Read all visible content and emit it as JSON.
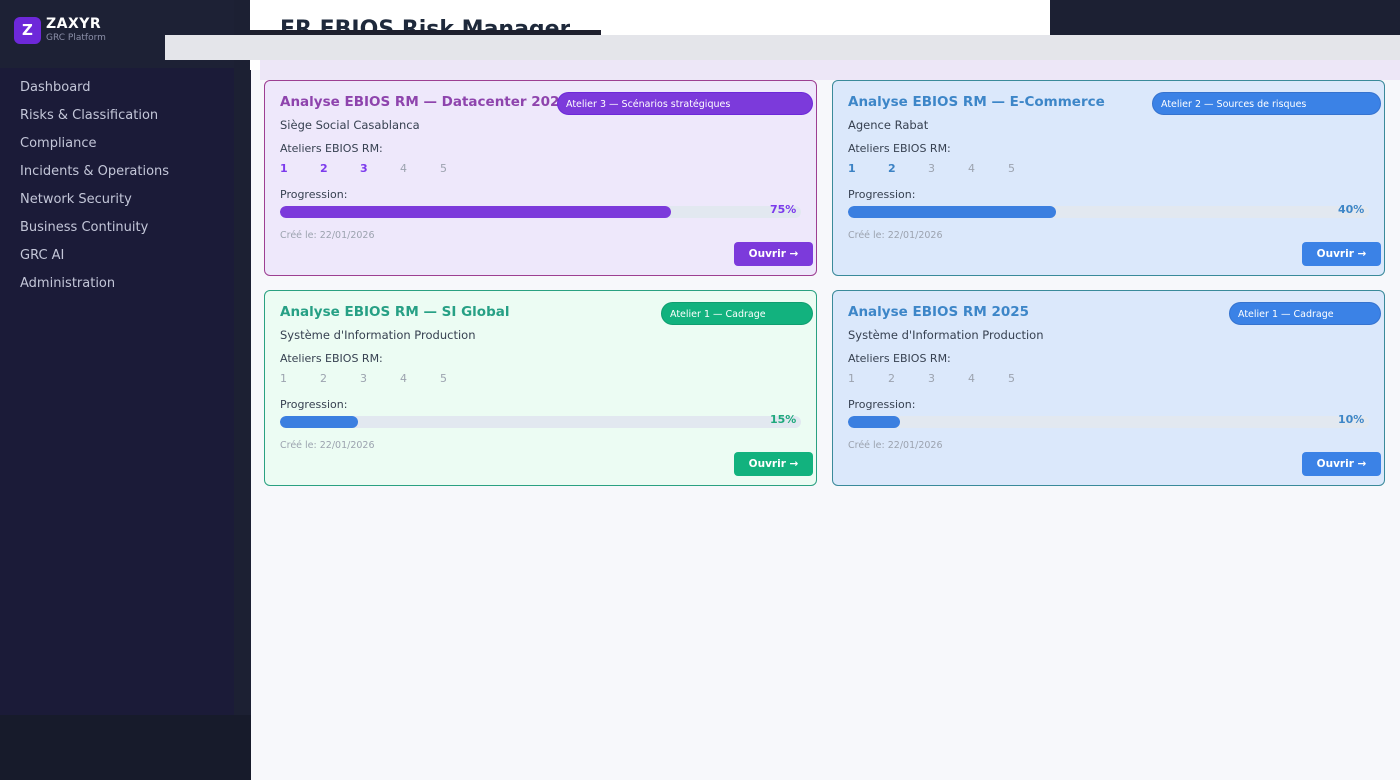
{
  "brand": {
    "logo_letter": "Z",
    "name": "ZAXYR",
    "subtitle": "GRC Platform"
  },
  "sidebar": {
    "items": [
      {
        "label": "Dashboard"
      },
      {
        "label": "Risks & Classification"
      },
      {
        "label": "Compliance"
      },
      {
        "label": "Incidents & Operations"
      },
      {
        "label": "Network Security"
      },
      {
        "label": "Business Continuity"
      },
      {
        "label": "GRC AI"
      },
      {
        "label": "Administration"
      }
    ]
  },
  "header": {
    "title": "FR  EBIOS Risk Manager"
  },
  "common": {
    "ateliers_label": "Ateliers EBIOS RM:",
    "progress_label": "Progression:",
    "open_label": "Ouvrir →",
    "steps": [
      "1",
      "2",
      "3",
      "4",
      "5"
    ]
  },
  "cards": [
    {
      "title": "Analyse EBIOS RM — Datacenter 2025",
      "badge": "Atelier 3 — Scénarios stratégiques",
      "site": "Siège Social Casablanca",
      "completed_steps": 3,
      "progress": 75,
      "progress_text": "75%",
      "created": "Créé le: 22/01/2026",
      "theme": "purple"
    },
    {
      "title": "Analyse EBIOS RM — E-Commerce",
      "badge": "Atelier 2 — Sources de risques",
      "site": "Agence Rabat",
      "completed_steps": 2,
      "progress": 40,
      "progress_text": "40%",
      "created": "Créé le: 22/01/2026",
      "theme": "blue"
    },
    {
      "title": "Analyse EBIOS RM — SI Global",
      "badge": "Atelier 1 — Cadrage",
      "site": "Système d'Information Production",
      "completed_steps": 0,
      "progress": 15,
      "progress_text": "15%",
      "created": "Créé le: 22/01/2026",
      "theme": "green"
    },
    {
      "title": "Analyse EBIOS RM 2025",
      "badge": "Atelier 1 — Cadrage",
      "site": "Système d'Information Production",
      "completed_steps": 0,
      "progress": 10,
      "progress_text": "10%",
      "created": "Créé le: 22/01/2026",
      "theme": "blue"
    }
  ]
}
